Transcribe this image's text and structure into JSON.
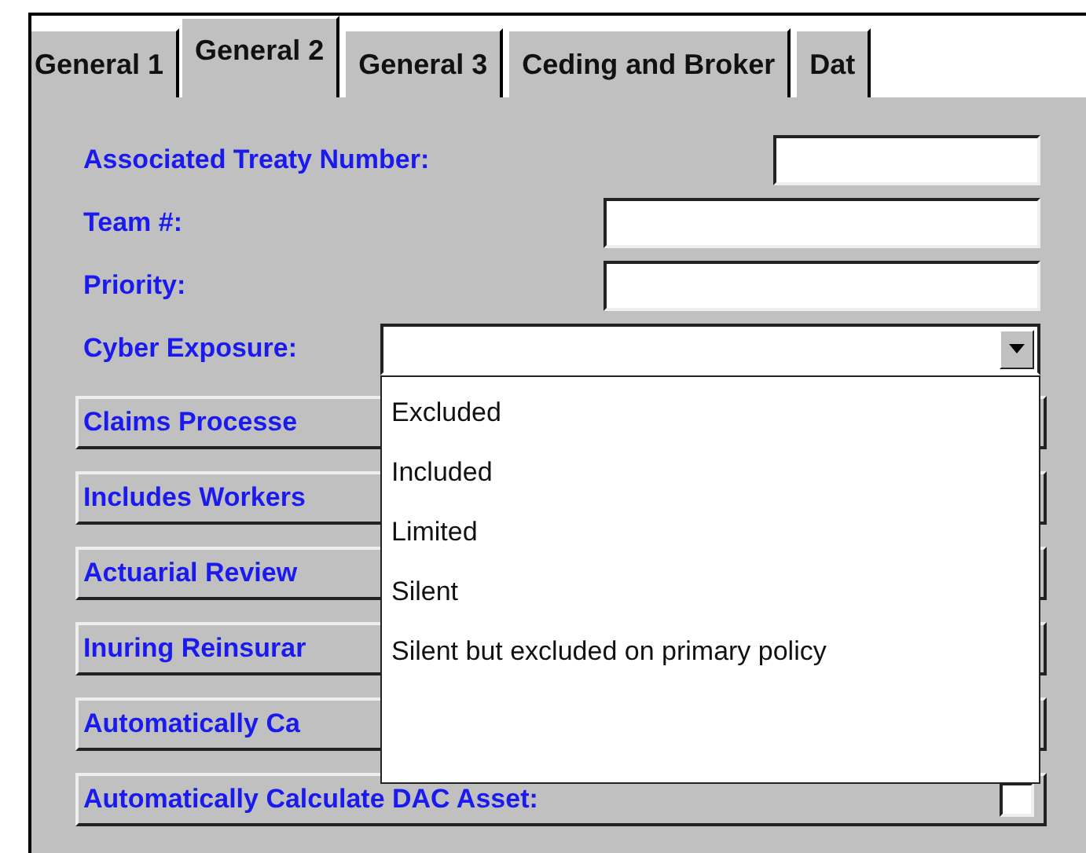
{
  "tabs": [
    {
      "label": "General 1",
      "selected": false
    },
    {
      "label": "General 2",
      "selected": true
    },
    {
      "label": "General 3",
      "selected": false
    },
    {
      "label": "Ceding and Broker",
      "selected": false
    },
    {
      "label": "Dat",
      "selected": false
    }
  ],
  "fields": [
    {
      "label": "Associated Treaty Number:",
      "kind": "short"
    },
    {
      "label": "Team #:",
      "kind": "text"
    },
    {
      "label": "Priority:",
      "kind": "text"
    },
    {
      "label": "Cyber Exposure:",
      "kind": "combo",
      "expanded": true,
      "options": [
        {
          "label": "Excluded",
          "selected": false
        },
        {
          "label": "Included",
          "selected": false
        },
        {
          "label": "Limited",
          "selected": false
        },
        {
          "label": "Silent",
          "selected": false
        },
        {
          "label": "Silent but excluded on primary policy",
          "selected": false
        }
      ]
    }
  ],
  "checkbox_rows": [
    {
      "label": "Claims Processe"
    },
    {
      "label": "Includes Workers"
    },
    {
      "label": "Actuarial Review"
    },
    {
      "label": "Inuring Reinsurar"
    },
    {
      "label": "Automatically Ca"
    },
    {
      "label": "Automatically Calculate DAC Asset:",
      "checked": false
    }
  ]
}
